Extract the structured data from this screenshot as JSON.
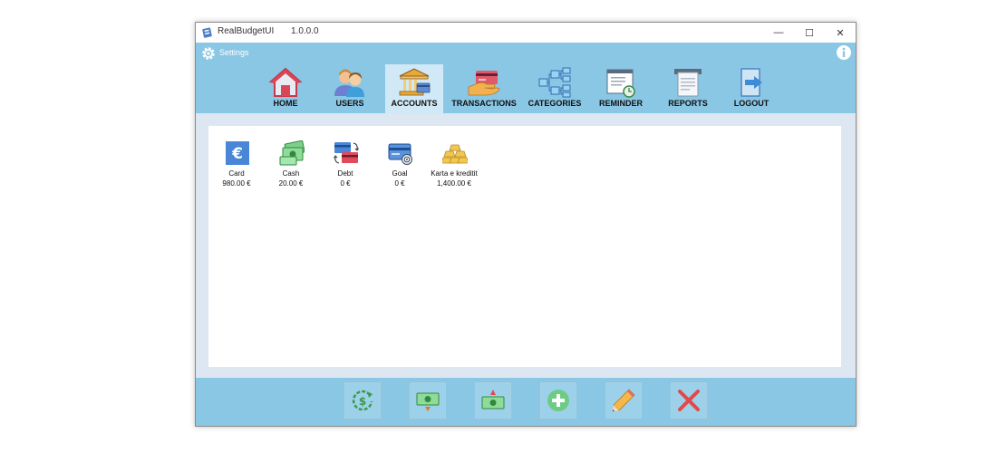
{
  "window": {
    "title": "RealBudgetUI",
    "version": "1.0.0.0",
    "controls": {
      "minimize": "—",
      "maximize": "☐",
      "close": "✕"
    }
  },
  "settings": {
    "label": "Settings",
    "gear_icon": "gear-icon",
    "info_icon": "info-icon"
  },
  "nav": {
    "items": [
      {
        "label": "HOME",
        "icon": "home-icon"
      },
      {
        "label": "USERS",
        "icon": "users-icon"
      },
      {
        "label": "ACCOUNTS",
        "icon": "bank-icon",
        "active": true
      },
      {
        "label": "TRANSACTIONS",
        "icon": "card-hand-icon"
      },
      {
        "label": "CATEGORIES",
        "icon": "hierarchy-icon"
      },
      {
        "label": "REMINDER",
        "icon": "clock-doc-icon"
      },
      {
        "label": "REPORTS",
        "icon": "printer-icon"
      },
      {
        "label": "LOGOUT",
        "icon": "logout-icon"
      }
    ]
  },
  "accounts": [
    {
      "name": "Card",
      "value": "980.00 €",
      "icon": "euro-icon"
    },
    {
      "name": "Cash",
      "value": "20.00 €",
      "icon": "cash-icon"
    },
    {
      "name": "Debt",
      "value": "0 €",
      "icon": "debt-icon"
    },
    {
      "name": "Goal",
      "value": "0 €",
      "icon": "goal-icon"
    },
    {
      "name": "Karta e kreditit",
      "value": "1,400.00 €",
      "icon": "gold-bars-icon"
    }
  ],
  "actions": [
    {
      "icon": "refresh-dollar-icon"
    },
    {
      "icon": "cash-down-icon"
    },
    {
      "icon": "cash-up-icon"
    },
    {
      "icon": "add-icon"
    },
    {
      "icon": "pencil-icon"
    },
    {
      "icon": "delete-icon"
    }
  ],
  "colors": {
    "bar": "#8ac7e4",
    "active_tab": "#d1e9f6",
    "content_frame": "#dde7f2"
  }
}
